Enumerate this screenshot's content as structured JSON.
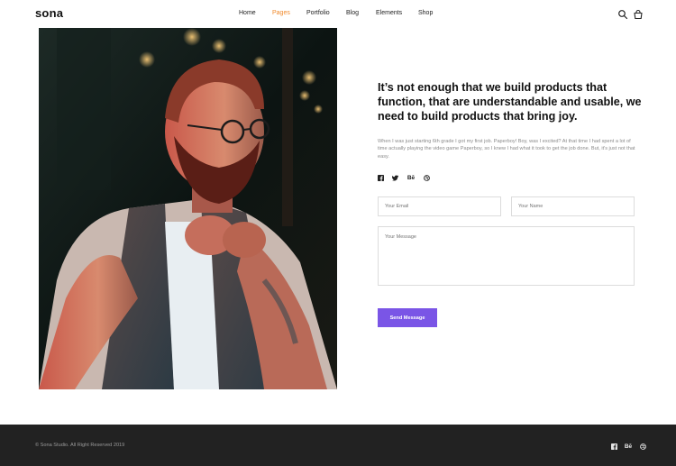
{
  "header": {
    "logo": "sona",
    "nav": [
      {
        "label": "Home",
        "active": false
      },
      {
        "label": "Pages",
        "active": true
      },
      {
        "label": "Portfolio",
        "active": false
      },
      {
        "label": "Blog",
        "active": false
      },
      {
        "label": "Elements",
        "active": false
      },
      {
        "label": "Shop",
        "active": false
      }
    ],
    "icons": [
      "search-icon",
      "shopping-bag-icon"
    ]
  },
  "content": {
    "headline": "It’s not enough that we build products that function, that are understandable and usable, we need to build products that bring joy.",
    "body": "When I was just starting 6th grade I got my first job. Paperboy! Boy, was I excited? At that time I had spent a lot of time actually playing the video game Paperboy, so I knew I had what it took to get the job done. But, it's just not that easy.",
    "socials": [
      "facebook-icon",
      "twitter-icon",
      "behance-icon",
      "dribbble-icon"
    ]
  },
  "form": {
    "email_placeholder": "Your Email",
    "name_placeholder": "Your Name",
    "message_placeholder": "Your Message",
    "submit_label": "Send Message"
  },
  "footer": {
    "copyright": "© Sona Studio. All Right Reserved 2019",
    "socials": [
      "facebook-icon",
      "behance-icon",
      "dribbble-icon"
    ]
  },
  "colors": {
    "accent_nav": "#f08a2c",
    "button": "#7a55e6",
    "footer_bg": "#222222"
  }
}
